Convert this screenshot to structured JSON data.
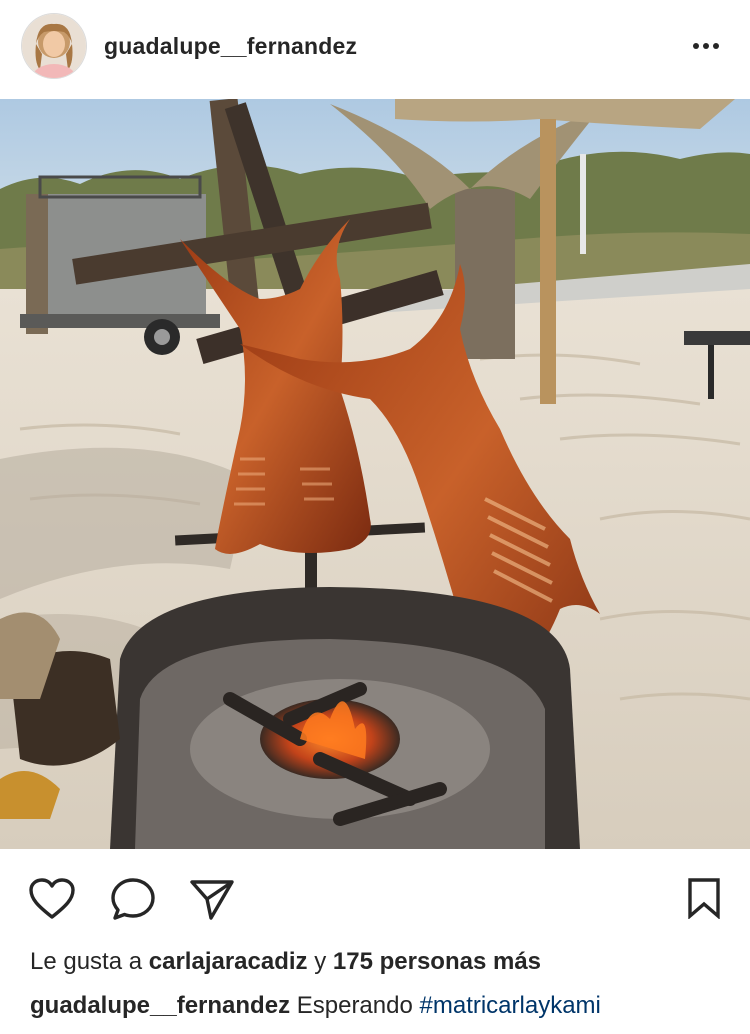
{
  "post": {
    "username": "guadalupe__fernandez",
    "avatar_icon": "profile-photo",
    "photo_alt": "photo",
    "more_icon": "more-options-icon"
  },
  "actions": {
    "like_icon": "heart-icon",
    "comment_icon": "comment-icon",
    "share_icon": "send-icon",
    "save_icon": "bookmark-icon"
  },
  "likes": {
    "prefix": "Le gusta a",
    "user": "carlajaracadiz",
    "connector": "y",
    "count_text": "175 personas más"
  },
  "caption": {
    "username": "guadalupe__fernandez",
    "text": "Esperando",
    "hashtag": "#matricarlaykami"
  },
  "colors": {
    "text": "#262626",
    "hashtag": "#003569",
    "background": "#ffffff"
  }
}
